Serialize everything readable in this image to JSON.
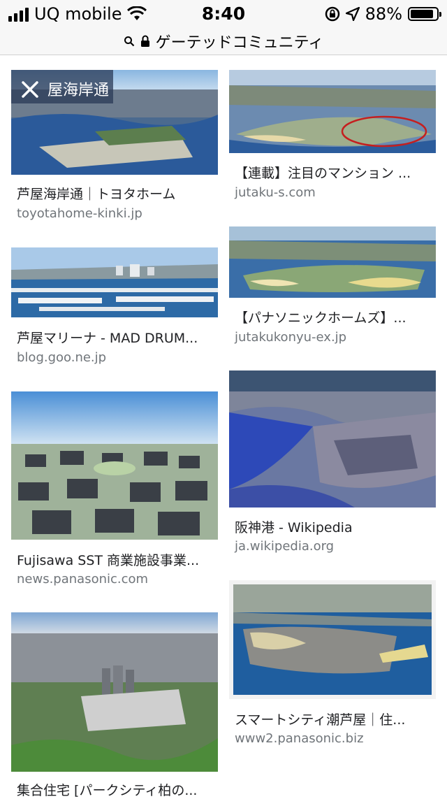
{
  "status_bar": {
    "carrier": "UQ mobile",
    "time": "8:40",
    "battery": "88%"
  },
  "url_bar": {
    "query": "ゲーテッドコミュニティ"
  },
  "results": [
    {
      "caption": "芦屋海岸通｜トヨタホーム",
      "domain": "toyotahome-kinki.jp",
      "overlay_text": "屋海岸通"
    },
    {
      "caption": "【連載】注目のマンション ...",
      "domain": "jutaku-s.com"
    },
    {
      "caption": "芦屋マリーナ - MAD DRUM...",
      "domain": "blog.goo.ne.jp"
    },
    {
      "caption": "【パナソニックホームズ】...",
      "domain": "jutakukonyu-ex.jp"
    },
    {
      "caption": "Fujisawa SST 商業施設事業...",
      "domain": "news.panasonic.com"
    },
    {
      "caption": "阪神港 - Wikipedia",
      "domain": "ja.wikipedia.org"
    },
    {
      "caption": "集合住宅 [パークシティ柏の...",
      "domain": ""
    },
    {
      "caption": "スマートシティ潮芦屋｜住...",
      "domain": "www2.panasonic.biz"
    }
  ]
}
